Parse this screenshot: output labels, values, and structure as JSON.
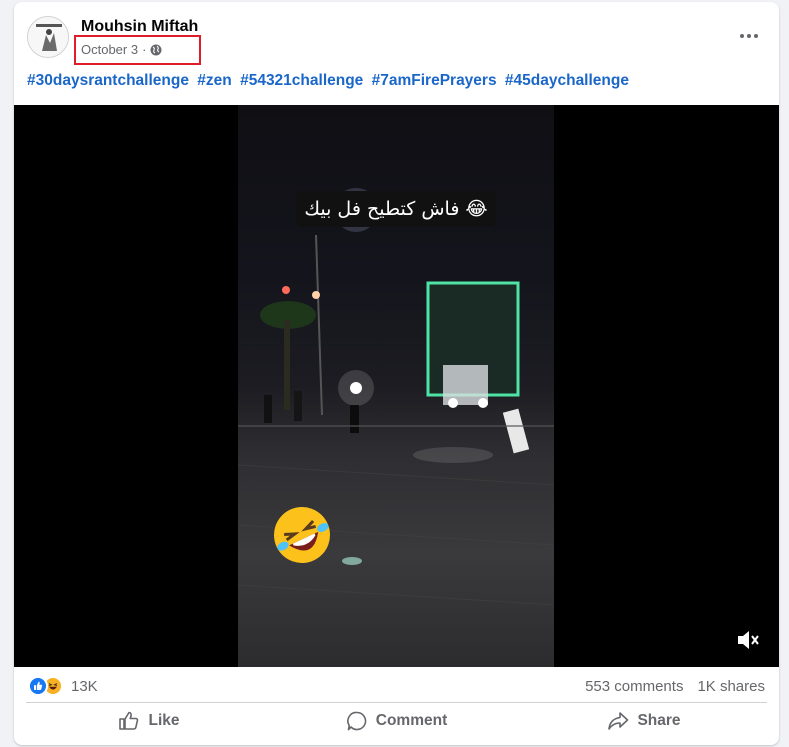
{
  "post": {
    "author": "Mouhsin Miftah",
    "date": "October 3",
    "separator": "·",
    "privacy_icon": "globe-icon",
    "hashtags": [
      "#30daysrantchallenge",
      "#zen",
      "#54321challenge",
      "#7amFirePrayers",
      "#45daychallenge"
    ],
    "more_icon": "more-options-icon"
  },
  "video": {
    "caption": "فاش كتطيح فل بيك",
    "caption_emoji": "😂",
    "overlay_emoji": "🤣",
    "mute_icon": "volume-muted-icon"
  },
  "stats": {
    "reaction_icons": [
      "like-icon",
      "haha-icon"
    ],
    "reaction_count": "13K",
    "comments": "553 comments",
    "shares": "1K shares"
  },
  "actions": {
    "like_label": "Like",
    "comment_label": "Comment",
    "share_label": "Share"
  },
  "colors": {
    "highlight_box": "#e11c2a",
    "hashtag": "#1b67c9",
    "like_blue": "#1877f2",
    "haha_yellow": "#f7b125"
  }
}
